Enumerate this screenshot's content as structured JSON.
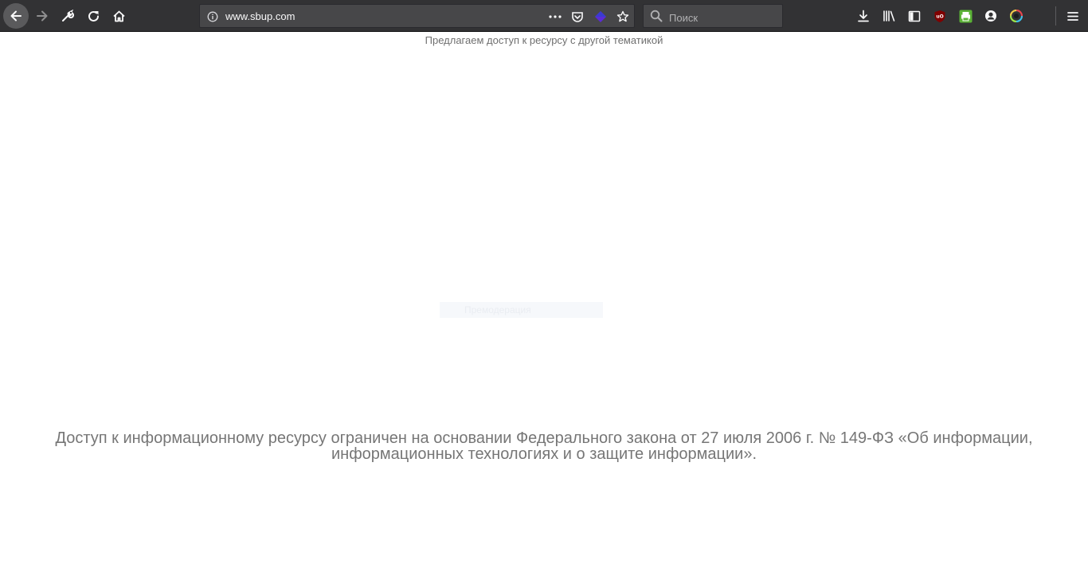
{
  "browser": {
    "url": "www.sbup.com",
    "search_placeholder": "Поиск",
    "accent_color": "#323234",
    "icons": [
      "back-icon",
      "forward-icon",
      "wrench-icon",
      "reload-icon",
      "home-icon",
      "info-icon",
      "more-icon",
      "pocket-icon",
      "extension-icon",
      "star-icon",
      "search-icon",
      "download-icon",
      "library-icon",
      "sidebar-icon",
      "ublock-icon",
      "printer-icon",
      "account-icon",
      "color-extension-icon",
      "menu-icon"
    ]
  },
  "page": {
    "top_note": "Предлагаем доступ к ресурсу с другой тематикой",
    "ghost_label": "Премодерация",
    "law_text_line1": "Доступ к информационному ресурсу ограничен на основании Федерального закона от 27 июля 2006 г. № 149-ФЗ «Об информации,",
    "law_text_line2": "информационных технологиях и о защите информации»."
  }
}
